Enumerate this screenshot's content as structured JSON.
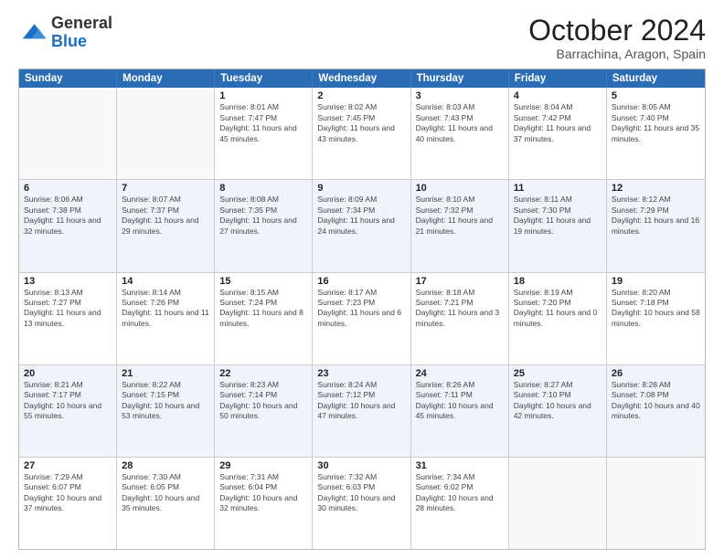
{
  "header": {
    "logo": {
      "general": "General",
      "blue": "Blue"
    },
    "title": "October 2024",
    "subtitle": "Barrachina, Aragon, Spain"
  },
  "calendar": {
    "days": [
      "Sunday",
      "Monday",
      "Tuesday",
      "Wednesday",
      "Thursday",
      "Friday",
      "Saturday"
    ],
    "weeks": [
      [
        {
          "day": "",
          "info": ""
        },
        {
          "day": "",
          "info": ""
        },
        {
          "day": "1",
          "info": "Sunrise: 8:01 AM\nSunset: 7:47 PM\nDaylight: 11 hours and 45 minutes."
        },
        {
          "day": "2",
          "info": "Sunrise: 8:02 AM\nSunset: 7:45 PM\nDaylight: 11 hours and 43 minutes."
        },
        {
          "day": "3",
          "info": "Sunrise: 8:03 AM\nSunset: 7:43 PM\nDaylight: 11 hours and 40 minutes."
        },
        {
          "day": "4",
          "info": "Sunrise: 8:04 AM\nSunset: 7:42 PM\nDaylight: 11 hours and 37 minutes."
        },
        {
          "day": "5",
          "info": "Sunrise: 8:05 AM\nSunset: 7:40 PM\nDaylight: 11 hours and 35 minutes."
        }
      ],
      [
        {
          "day": "6",
          "info": "Sunrise: 8:06 AM\nSunset: 7:38 PM\nDaylight: 11 hours and 32 minutes."
        },
        {
          "day": "7",
          "info": "Sunrise: 8:07 AM\nSunset: 7:37 PM\nDaylight: 11 hours and 29 minutes."
        },
        {
          "day": "8",
          "info": "Sunrise: 8:08 AM\nSunset: 7:35 PM\nDaylight: 11 hours and 27 minutes."
        },
        {
          "day": "9",
          "info": "Sunrise: 8:09 AM\nSunset: 7:34 PM\nDaylight: 11 hours and 24 minutes."
        },
        {
          "day": "10",
          "info": "Sunrise: 8:10 AM\nSunset: 7:32 PM\nDaylight: 11 hours and 21 minutes."
        },
        {
          "day": "11",
          "info": "Sunrise: 8:11 AM\nSunset: 7:30 PM\nDaylight: 11 hours and 19 minutes."
        },
        {
          "day": "12",
          "info": "Sunrise: 8:12 AM\nSunset: 7:29 PM\nDaylight: 11 hours and 16 minutes."
        }
      ],
      [
        {
          "day": "13",
          "info": "Sunrise: 8:13 AM\nSunset: 7:27 PM\nDaylight: 11 hours and 13 minutes."
        },
        {
          "day": "14",
          "info": "Sunrise: 8:14 AM\nSunset: 7:26 PM\nDaylight: 11 hours and 11 minutes."
        },
        {
          "day": "15",
          "info": "Sunrise: 8:15 AM\nSunset: 7:24 PM\nDaylight: 11 hours and 8 minutes."
        },
        {
          "day": "16",
          "info": "Sunrise: 8:17 AM\nSunset: 7:23 PM\nDaylight: 11 hours and 6 minutes."
        },
        {
          "day": "17",
          "info": "Sunrise: 8:18 AM\nSunset: 7:21 PM\nDaylight: 11 hours and 3 minutes."
        },
        {
          "day": "18",
          "info": "Sunrise: 8:19 AM\nSunset: 7:20 PM\nDaylight: 11 hours and 0 minutes."
        },
        {
          "day": "19",
          "info": "Sunrise: 8:20 AM\nSunset: 7:18 PM\nDaylight: 10 hours and 58 minutes."
        }
      ],
      [
        {
          "day": "20",
          "info": "Sunrise: 8:21 AM\nSunset: 7:17 PM\nDaylight: 10 hours and 55 minutes."
        },
        {
          "day": "21",
          "info": "Sunrise: 8:22 AM\nSunset: 7:15 PM\nDaylight: 10 hours and 53 minutes."
        },
        {
          "day": "22",
          "info": "Sunrise: 8:23 AM\nSunset: 7:14 PM\nDaylight: 10 hours and 50 minutes."
        },
        {
          "day": "23",
          "info": "Sunrise: 8:24 AM\nSunset: 7:12 PM\nDaylight: 10 hours and 47 minutes."
        },
        {
          "day": "24",
          "info": "Sunrise: 8:26 AM\nSunset: 7:11 PM\nDaylight: 10 hours and 45 minutes."
        },
        {
          "day": "25",
          "info": "Sunrise: 8:27 AM\nSunset: 7:10 PM\nDaylight: 10 hours and 42 minutes."
        },
        {
          "day": "26",
          "info": "Sunrise: 8:28 AM\nSunset: 7:08 PM\nDaylight: 10 hours and 40 minutes."
        }
      ],
      [
        {
          "day": "27",
          "info": "Sunrise: 7:29 AM\nSunset: 6:07 PM\nDaylight: 10 hours and 37 minutes."
        },
        {
          "day": "28",
          "info": "Sunrise: 7:30 AM\nSunset: 6:05 PM\nDaylight: 10 hours and 35 minutes."
        },
        {
          "day": "29",
          "info": "Sunrise: 7:31 AM\nSunset: 6:04 PM\nDaylight: 10 hours and 32 minutes."
        },
        {
          "day": "30",
          "info": "Sunrise: 7:32 AM\nSunset: 6:03 PM\nDaylight: 10 hours and 30 minutes."
        },
        {
          "day": "31",
          "info": "Sunrise: 7:34 AM\nSunset: 6:02 PM\nDaylight: 10 hours and 28 minutes."
        },
        {
          "day": "",
          "info": ""
        },
        {
          "day": "",
          "info": ""
        }
      ]
    ]
  }
}
